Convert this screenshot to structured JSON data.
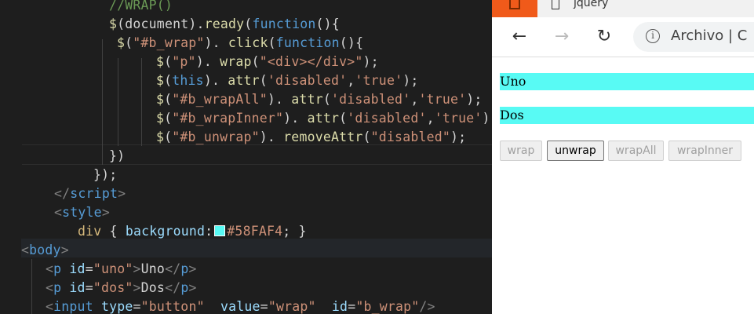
{
  "editor": {
    "lines": [
      [
        [
          "c-com",
          "//WRAP()"
        ]
      ],
      [
        [
          "c-fn",
          "$"
        ],
        [
          "c-def",
          "(document)."
        ],
        [
          "c-fn",
          "ready"
        ],
        [
          "c-def",
          "("
        ],
        [
          "c-kw",
          "function"
        ],
        [
          "c-def",
          "(){"
        ]
      ],
      [
        [
          "c-fn",
          "$"
        ],
        [
          "c-def",
          "("
        ],
        [
          "c-str",
          "\"#b_wrap\""
        ],
        [
          "c-def",
          "). "
        ],
        [
          "c-fn",
          "click"
        ],
        [
          "c-def",
          "("
        ],
        [
          "c-kw",
          "function"
        ],
        [
          "c-def",
          "(){"
        ]
      ],
      [
        [
          "c-fn",
          "$"
        ],
        [
          "c-def",
          "("
        ],
        [
          "c-str",
          "\"p\""
        ],
        [
          "c-def",
          "). "
        ],
        [
          "c-fn",
          "wrap"
        ],
        [
          "c-def",
          "("
        ],
        [
          "c-str",
          "\"<div></div>\""
        ],
        [
          "c-def",
          "); "
        ]
      ],
      [
        [
          "c-fn",
          "$"
        ],
        [
          "c-def",
          "("
        ],
        [
          "c-kw",
          "this"
        ],
        [
          "c-def",
          "). "
        ],
        [
          "c-fn",
          "attr"
        ],
        [
          "c-def",
          "("
        ],
        [
          "c-str",
          "'disabled'"
        ],
        [
          "c-def",
          ","
        ],
        [
          "c-str",
          "'true'"
        ],
        [
          "c-def",
          "); "
        ]
      ],
      [
        [
          "c-fn",
          "$"
        ],
        [
          "c-def",
          "("
        ],
        [
          "c-str",
          "\"#b_wrapAll\""
        ],
        [
          "c-def",
          "). "
        ],
        [
          "c-fn",
          "attr"
        ],
        [
          "c-def",
          "("
        ],
        [
          "c-str",
          "'disabled'"
        ],
        [
          "c-def",
          ","
        ],
        [
          "c-str",
          "'true'"
        ],
        [
          "c-def",
          "); "
        ]
      ],
      [
        [
          "c-fn",
          "$"
        ],
        [
          "c-def",
          "("
        ],
        [
          "c-str",
          "\"#b_wrapInner\""
        ],
        [
          "c-def",
          "). "
        ],
        [
          "c-fn",
          "attr"
        ],
        [
          "c-def",
          "("
        ],
        [
          "c-str",
          "'disabled'"
        ],
        [
          "c-def",
          ","
        ],
        [
          "c-str",
          "'true'"
        ],
        [
          "c-def",
          "); "
        ]
      ],
      [
        [
          "c-fn",
          "$"
        ],
        [
          "c-def",
          "("
        ],
        [
          "c-str",
          "\"#b_unwrap\""
        ],
        [
          "c-def",
          "). "
        ],
        [
          "c-fn",
          "removeAttr"
        ],
        [
          "c-def",
          "("
        ],
        [
          "c-str",
          "\"disabled\""
        ],
        [
          "c-def",
          "); "
        ]
      ],
      [
        [
          "c-def",
          "})"
        ]
      ],
      [
        [
          "c-def",
          "});"
        ]
      ],
      [
        [
          "c-punc",
          "</"
        ],
        [
          "c-tag",
          "script"
        ],
        [
          "c-punc",
          ">"
        ]
      ],
      [
        [
          "c-punc",
          "<"
        ],
        [
          "c-tag",
          "style"
        ],
        [
          "c-punc",
          ">"
        ]
      ],
      [
        [
          "c-sel",
          "div"
        ],
        [
          "c-def",
          " { "
        ],
        [
          "c-prop",
          "background"
        ],
        [
          "c-def",
          ":"
        ],
        [
          "swatch",
          "#58FAF4"
        ],
        [
          "c-str",
          "#58FAF4"
        ],
        [
          "c-def",
          "; }"
        ]
      ],
      [
        [
          "c-punc",
          "<"
        ],
        [
          "c-tag",
          "body"
        ],
        [
          "c-punc",
          ">"
        ]
      ],
      [
        [
          "c-punc",
          "<"
        ],
        [
          "c-tag",
          "p"
        ],
        [
          "c-def",
          " "
        ],
        [
          "c-attr",
          "id"
        ],
        [
          "c-def",
          "="
        ],
        [
          "c-str",
          "\"uno\""
        ],
        [
          "c-punc",
          ">"
        ],
        [
          "c-def",
          "Uno"
        ],
        [
          "c-punc",
          "</"
        ],
        [
          "c-tag",
          "p"
        ],
        [
          "c-punc",
          ">"
        ]
      ],
      [
        [
          "c-punc",
          "<"
        ],
        [
          "c-tag",
          "p"
        ],
        [
          "c-def",
          " "
        ],
        [
          "c-attr",
          "id"
        ],
        [
          "c-def",
          "="
        ],
        [
          "c-str",
          "\"dos\""
        ],
        [
          "c-punc",
          ">"
        ],
        [
          "c-def",
          "Dos"
        ],
        [
          "c-punc",
          "</"
        ],
        [
          "c-tag",
          "p"
        ],
        [
          "c-punc",
          ">"
        ]
      ],
      [
        [
          "c-punc",
          "<"
        ],
        [
          "c-tag",
          "input"
        ],
        [
          "c-def",
          " "
        ],
        [
          "c-attr",
          "type"
        ],
        [
          "c-def",
          "="
        ],
        [
          "c-str",
          "\"button\""
        ],
        [
          "c-def",
          "  "
        ],
        [
          "c-attr",
          "value"
        ],
        [
          "c-def",
          "="
        ],
        [
          "c-str",
          "\"wrap\""
        ],
        [
          "c-def",
          "  "
        ],
        [
          "c-attr",
          "id"
        ],
        [
          "c-def",
          "="
        ],
        [
          "c-str",
          "\"b_wrap\""
        ],
        [
          "c-punc",
          "/>"
        ]
      ]
    ]
  },
  "browser": {
    "tab_title": "jquery",
    "url_text": "Archivo  |  C",
    "info_icon": "i",
    "nav": {
      "back": "←",
      "forward": "→",
      "reload": "↻"
    },
    "paragraphs": [
      "Uno",
      "Dos"
    ],
    "highlight_color": "#58FAF4",
    "buttons": [
      {
        "label": "wrap",
        "disabled": true
      },
      {
        "label": "unwrap",
        "disabled": false
      },
      {
        "label": "wrapAll",
        "disabled": true
      },
      {
        "label": "wrapInner",
        "disabled": true
      }
    ]
  }
}
